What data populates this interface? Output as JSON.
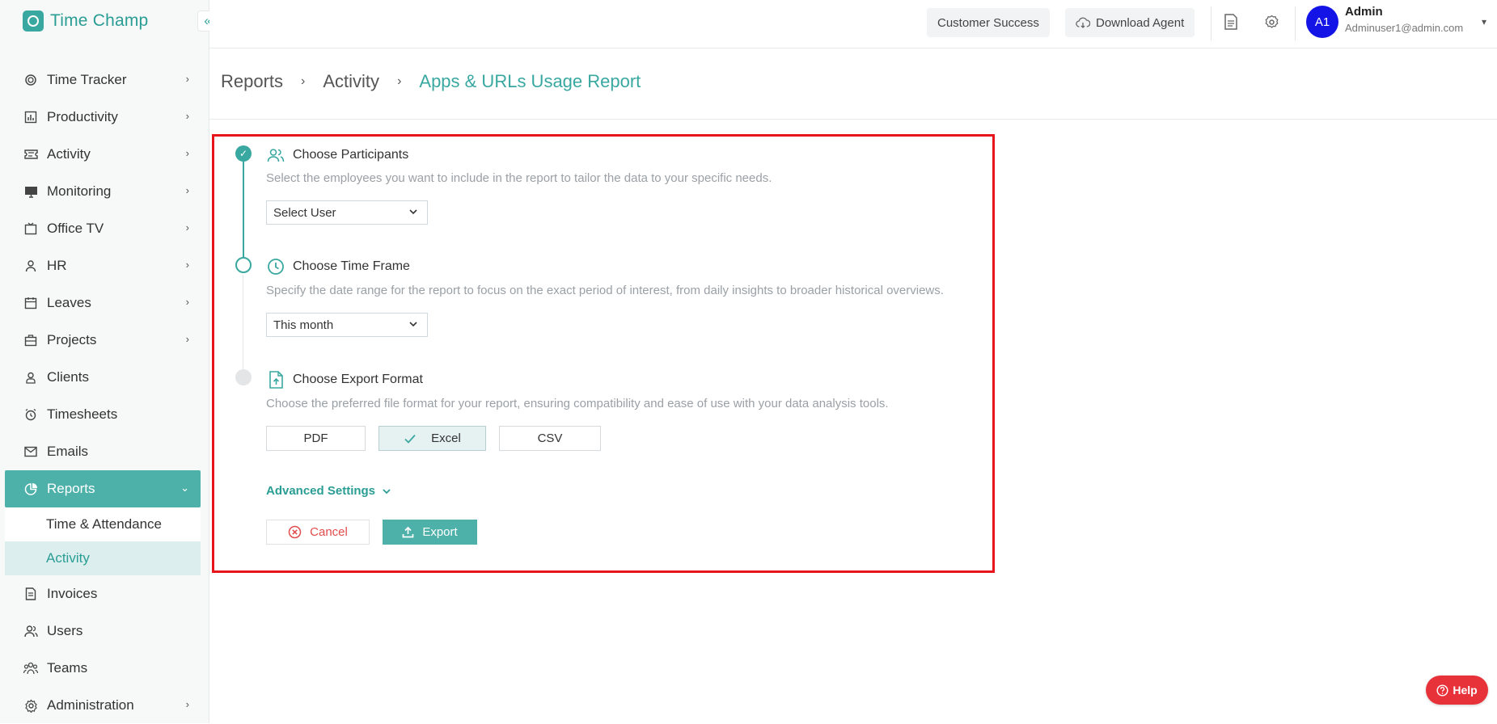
{
  "app": {
    "name": "Time Champ",
    "brand_color": "#39a8a0"
  },
  "sidebar": {
    "items": [
      {
        "label": "Time Tracker",
        "icon": "stopwatch-icon",
        "has_children": true
      },
      {
        "label": "Productivity",
        "icon": "bar-chart-icon",
        "has_children": true
      },
      {
        "label": "Activity",
        "icon": "ticket-icon",
        "has_children": true
      },
      {
        "label": "Monitoring",
        "icon": "monitor-icon",
        "has_children": true
      },
      {
        "label": "Office TV",
        "icon": "tv-icon",
        "has_children": true
      },
      {
        "label": "HR",
        "icon": "person-icon",
        "has_children": true
      },
      {
        "label": "Leaves",
        "icon": "calendar-icon",
        "has_children": true
      },
      {
        "label": "Projects",
        "icon": "briefcase-icon",
        "has_children": true
      },
      {
        "label": "Clients",
        "icon": "client-icon",
        "has_children": false
      },
      {
        "label": "Timesheets",
        "icon": "alarm-clock-icon",
        "has_children": false
      },
      {
        "label": "Emails",
        "icon": "mail-icon",
        "has_children": false
      },
      {
        "label": "Reports",
        "icon": "pie-chart-icon",
        "has_children": true,
        "active": true
      },
      {
        "label": "Invoices",
        "icon": "invoice-icon",
        "has_children": false
      },
      {
        "label": "Users",
        "icon": "users-icon",
        "has_children": false
      },
      {
        "label": "Teams",
        "icon": "teams-icon",
        "has_children": false
      },
      {
        "label": "Administration",
        "icon": "gear-icon",
        "has_children": true
      }
    ],
    "reports_sub": [
      {
        "label": "Time & Attendance"
      },
      {
        "label": "Activity",
        "active": true
      }
    ]
  },
  "topbar": {
    "customer_success": "Customer Success",
    "download_agent": "Download Agent",
    "user": {
      "initials": "A1",
      "name": "Admin",
      "email": "Adminuser1@admin.com",
      "avatar_color": "#1414e6"
    }
  },
  "breadcrumb": [
    "Reports",
    "Activity",
    "Apps & URLs Usage Report"
  ],
  "steps": {
    "participants": {
      "title": "Choose Participants",
      "description": "Select the employees you want to include in the report to tailor the data to your specific needs.",
      "select_value": "Select User"
    },
    "time_frame": {
      "title": "Choose Time Frame",
      "description": "Specify the date range for the report to focus on the exact period of interest, from daily insights to broader historical overviews.",
      "select_value": "This month"
    },
    "export_format": {
      "title": "Choose Export Format",
      "description": "Choose the preferred file format for your report, ensuring compatibility and ease of use with your data analysis tools.",
      "options": [
        "PDF",
        "Excel",
        "CSV"
      ],
      "selected": "Excel"
    }
  },
  "advanced_settings": "Advanced Settings",
  "actions": {
    "cancel": "Cancel",
    "export": "Export"
  },
  "help": "Help",
  "highlight_color": "#e8141b"
}
